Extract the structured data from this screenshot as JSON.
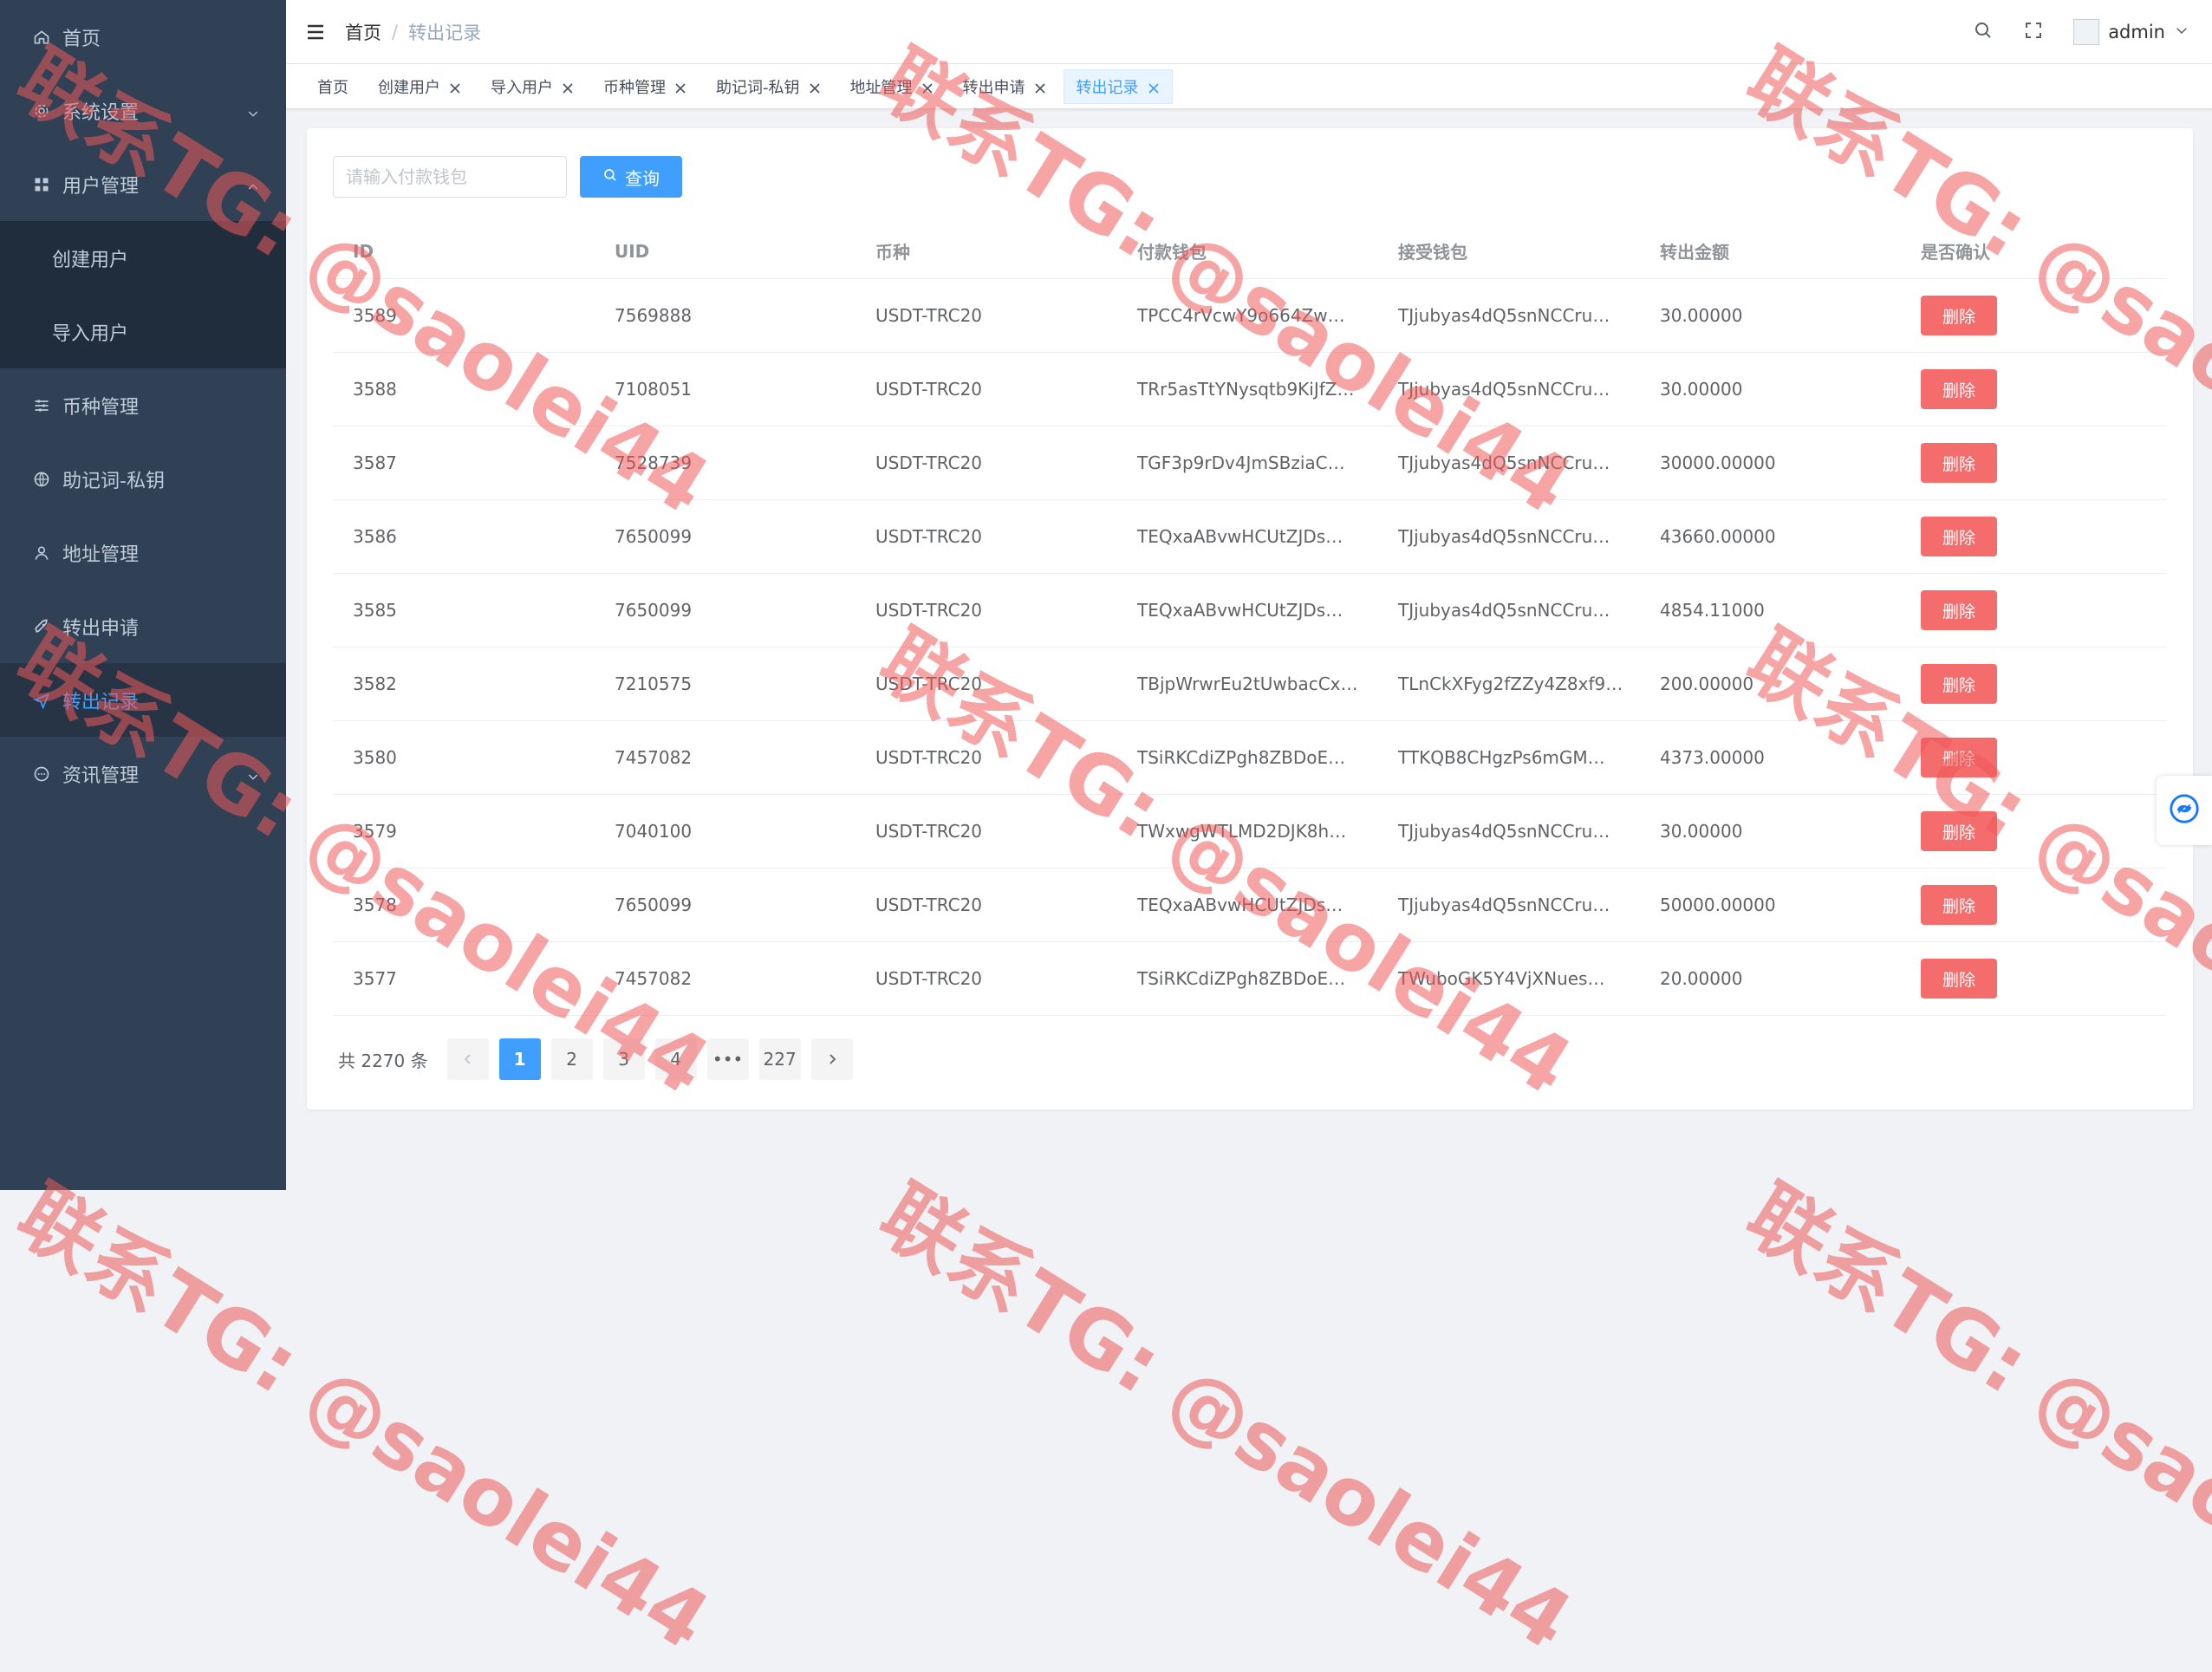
{
  "sidebar": {
    "items": [
      {
        "label": "首页",
        "icon": "home-icon"
      },
      {
        "label": "系统设置",
        "icon": "gear-icon",
        "arrow": "down"
      },
      {
        "label": "用户管理",
        "icon": "grid-icon",
        "arrow": "up"
      },
      {
        "label": "创建用户"
      },
      {
        "label": "导入用户"
      },
      {
        "label": "币种管理",
        "icon": "sliders-icon"
      },
      {
        "label": "助记词-私钥",
        "icon": "globe-icon"
      },
      {
        "label": "地址管理",
        "icon": "user-icon"
      },
      {
        "label": "转出申请",
        "icon": "rocket-icon"
      },
      {
        "label": "转出记录",
        "icon": "send-icon"
      },
      {
        "label": "资讯管理",
        "icon": "chat-icon",
        "arrow": "down"
      }
    ]
  },
  "navbar": {
    "breadcrumb_home": "首页",
    "breadcrumb_sep": "/",
    "breadcrumb_current": "转出记录",
    "username": "admin"
  },
  "tags": [
    {
      "label": "首页",
      "closable": false
    },
    {
      "label": "创建用户",
      "closable": true
    },
    {
      "label": "导入用户",
      "closable": true
    },
    {
      "label": "币种管理",
      "closable": true
    },
    {
      "label": "助记词-私钥",
      "closable": true
    },
    {
      "label": "地址管理",
      "closable": true
    },
    {
      "label": "转出申请",
      "closable": true
    },
    {
      "label": "转出记录",
      "closable": true,
      "active": true
    }
  ],
  "search": {
    "placeholder": "请输入付款钱包",
    "value": "",
    "button_label": "查询"
  },
  "table": {
    "headers": [
      "ID",
      "UID",
      "币种",
      "付款钱包",
      "接受钱包",
      "转出金额",
      "是否确认"
    ],
    "delete_label": "删除",
    "rows": [
      [
        "3589",
        "7569888",
        "USDT-TRC20",
        "TPCC4rVcwY9o664Zw…",
        "TJjubyas4dQ5snNCCru…",
        "30.00000"
      ],
      [
        "3588",
        "7108051",
        "USDT-TRC20",
        "TRr5asTtYNysqtb9KiJfZ…",
        "TJjubyas4dQ5snNCCru…",
        "30.00000"
      ],
      [
        "3587",
        "7528739",
        "USDT-TRC20",
        "TGF3p9rDv4JmSBziaC…",
        "TJjubyas4dQ5snNCCru…",
        "30000.00000"
      ],
      [
        "3586",
        "7650099",
        "USDT-TRC20",
        "TEQxaABvwHCUtZJDs…",
        "TJjubyas4dQ5snNCCru…",
        "43660.00000"
      ],
      [
        "3585",
        "7650099",
        "USDT-TRC20",
        "TEQxaABvwHCUtZJDs…",
        "TJjubyas4dQ5snNCCru…",
        "4854.11000"
      ],
      [
        "3582",
        "7210575",
        "USDT-TRC20",
        "TBjpWrwrEu2tUwbacCx…",
        "TLnCkXFyg2fZZy4Z8xf9…",
        "200.00000"
      ],
      [
        "3580",
        "7457082",
        "USDT-TRC20",
        "TSiRKCdiZPgh8ZBDoE…",
        "TTKQB8CHgzPs6mGM…",
        "4373.00000"
      ],
      [
        "3579",
        "7040100",
        "USDT-TRC20",
        "TWxwgWTLMD2DJK8h…",
        "TJjubyas4dQ5snNCCru…",
        "30.00000"
      ],
      [
        "3578",
        "7650099",
        "USDT-TRC20",
        "TEQxaABvwHCUtZJDs…",
        "TJjubyas4dQ5snNCCru…",
        "50000.00000"
      ],
      [
        "3577",
        "7457082",
        "USDT-TRC20",
        "TSiRKCdiZPgh8ZBDoE…",
        "TWuboGK5Y4VjXNues…",
        "20.00000"
      ]
    ]
  },
  "pagination": {
    "total_text": "共 2270 条",
    "pages": [
      "1",
      "2",
      "3",
      "4",
      "•••",
      "227"
    ],
    "current": "1"
  },
  "watermark": {
    "text": "联系TG: @saolei44"
  },
  "colors": {
    "sidebar_bg": "#304156",
    "primary": "#409eff",
    "danger": "#f56c6c",
    "watermark": "#ee5a5a"
  }
}
